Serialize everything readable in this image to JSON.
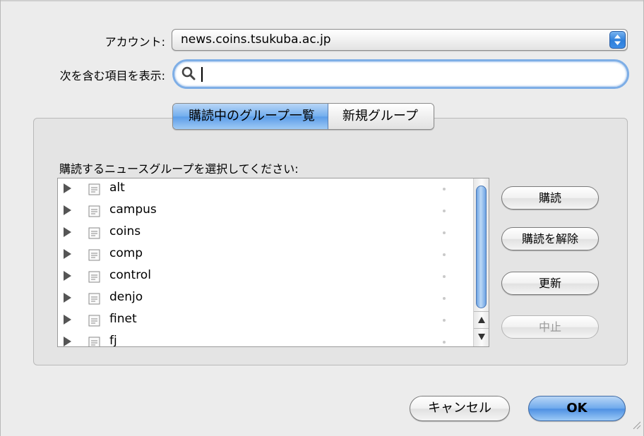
{
  "account": {
    "label": "アカウント:",
    "value": "news.coins.tsukuba.ac.jp"
  },
  "filter": {
    "label": "次を含む項目を表示:",
    "value": ""
  },
  "tabs": [
    {
      "label": "購読中のグループ一覧",
      "selected": true
    },
    {
      "label": "新規グループ",
      "selected": false
    }
  ],
  "list": {
    "caption": "購読するニュースグループを選択してください:",
    "items": [
      {
        "label": "alt"
      },
      {
        "label": "campus"
      },
      {
        "label": "coins"
      },
      {
        "label": "comp"
      },
      {
        "label": "control"
      },
      {
        "label": "denjo"
      },
      {
        "label": "finet"
      },
      {
        "label": "fj"
      }
    ]
  },
  "side_buttons": {
    "subscribe": "購読",
    "unsubscribe": "購読を解除",
    "refresh": "更新",
    "stop": "中止"
  },
  "footer": {
    "cancel": "キャンセル",
    "ok": "OK"
  },
  "colors": {
    "accent": "#5b9de8",
    "background": "#ececec"
  }
}
